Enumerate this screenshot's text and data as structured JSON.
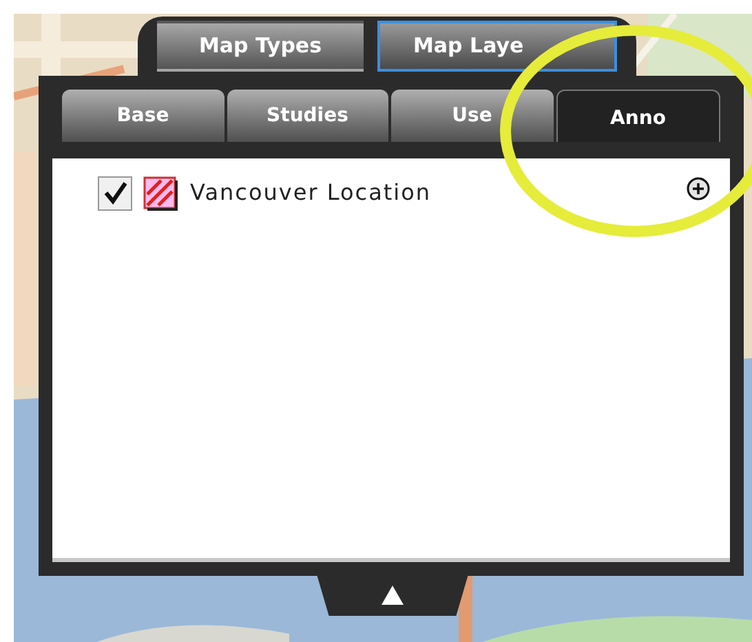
{
  "view_buttons": [
    {
      "label": "Map Types",
      "selected": false
    },
    {
      "label": "Map Laye",
      "selected": true
    }
  ],
  "tabs": [
    {
      "label": "Base",
      "selected": false
    },
    {
      "label": "Studies",
      "selected": false
    },
    {
      "label": "Use",
      "selected": false
    },
    {
      "label": "Anno",
      "selected": true
    }
  ],
  "layers": [
    {
      "label": "Vancouver Location",
      "checked": true
    }
  ]
}
